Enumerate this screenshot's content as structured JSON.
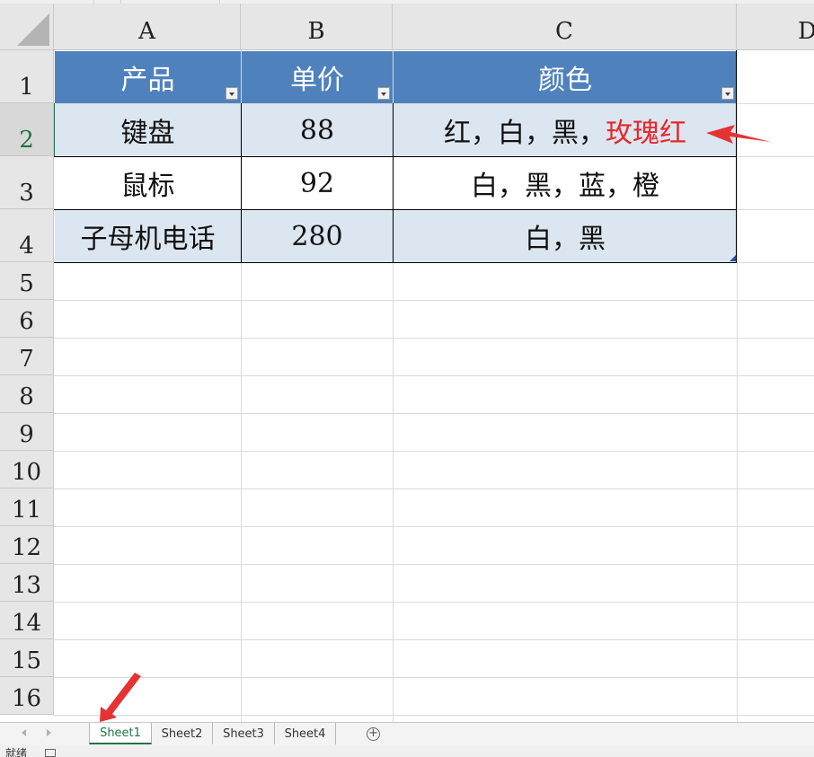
{
  "columns": [
    "A",
    "B",
    "C",
    "D"
  ],
  "rows": [
    "1",
    "2",
    "3",
    "4",
    "5",
    "6",
    "7",
    "8",
    "9",
    "10",
    "11",
    "12",
    "13",
    "14",
    "15",
    "16"
  ],
  "table": {
    "headers": [
      "产品",
      "单价",
      "颜色"
    ],
    "data": [
      {
        "product": "键盘",
        "price": "88",
        "colors": "红，白，黑，",
        "colors_highlight": "玫瑰红"
      },
      {
        "product": "鼠标",
        "price": "92",
        "colors": "白，黑，蓝，橙"
      },
      {
        "product": "子母机电话",
        "price": "280",
        "colors": "白，黑"
      }
    ]
  },
  "sheets": [
    "Sheet1",
    "Sheet2",
    "Sheet3",
    "Sheet4"
  ],
  "active_sheet": "Sheet1",
  "status_text": "就绪",
  "colors": {
    "header_fill": "#4f81bd",
    "band_fill": "#dce6f1",
    "highlight_text": "#e8262a",
    "annotation_arrow": "#e53333",
    "active_accent": "#217346"
  }
}
